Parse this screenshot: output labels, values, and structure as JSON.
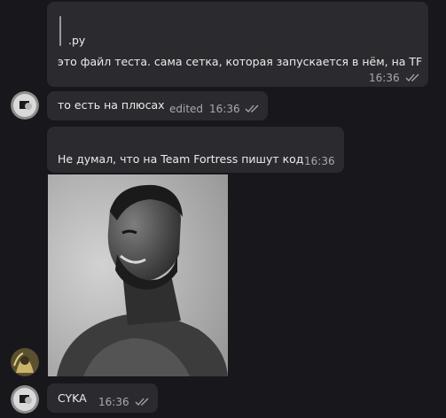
{
  "messages": [
    {
      "id": "m1",
      "quote_text": ".py",
      "text": "это файл теста. сама сетка, которая запускается в нём, на TF",
      "time": "16:36",
      "read": true
    },
    {
      "id": "m2",
      "text": "то есть на плюсах",
      "edited_label": "edited",
      "time": "16:36",
      "read": true
    },
    {
      "id": "m3",
      "text": "Не думал, что на Team Fortress пишут код",
      "time": "16:36"
    },
    {
      "id": "m4",
      "photo_icon": "portrait-photo"
    },
    {
      "id": "m5",
      "text": "CYKA",
      "time": "16:36",
      "read": true
    }
  ],
  "colors": {
    "background": "#18181c",
    "bubble": "#2b2b2f",
    "time": "#a9a9ad",
    "text": "#ececec"
  }
}
